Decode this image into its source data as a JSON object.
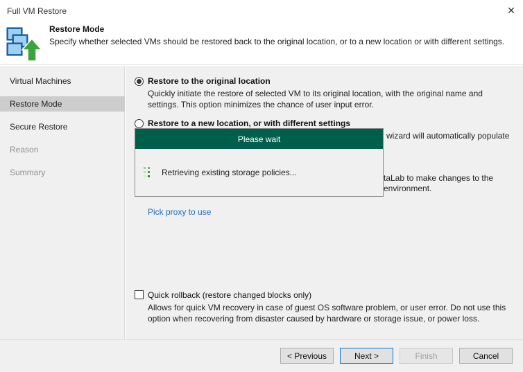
{
  "window": {
    "title": "Full VM Restore",
    "close_glyph": "✕"
  },
  "header": {
    "title": "Restore Mode",
    "description": "Specify whether selected VMs should be restored back to the original location, or to a new location or with different settings.",
    "icon": "vm-restore-icon"
  },
  "sidebar": {
    "steps": [
      {
        "label": "Virtual Machines",
        "state": "normal"
      },
      {
        "label": "Restore Mode",
        "state": "active"
      },
      {
        "label": "Secure Restore",
        "state": "normal"
      },
      {
        "label": "Reason",
        "state": "disabled"
      },
      {
        "label": "Summary",
        "state": "disabled"
      }
    ]
  },
  "main": {
    "option_original": {
      "label": "Restore to the original location",
      "desc_line1": "Quickly initiate the restore of selected VM to its original location, with the original name and",
      "desc_line2": "settings. This option minimizes the chance of user input error.",
      "selected": true
    },
    "option_new": {
      "label": "Restore to a new location, or with different settings",
      "desc_partial_1": "wizard will automatically populate",
      "desc_partial_2": "taLab to make changes to the",
      "desc_partial_3": "environment.",
      "selected": false
    },
    "pick_proxy_link": "Pick proxy to use",
    "quick_rollback": {
      "label": "Quick rollback (restore changed blocks only)",
      "desc_line1": "Allows for quick VM recovery in case of guest OS software problem, or user error. Do not use this",
      "desc_line2": "option when recovering from disaster caused by hardware or storage issue, or power loss.",
      "checked": false
    }
  },
  "wait_dialog": {
    "title": "Please wait",
    "message": "Retrieving existing storage policies..."
  },
  "footer": {
    "previous": "< Previous",
    "next": "Next >",
    "finish": "Finish",
    "cancel": "Cancel"
  },
  "colors": {
    "accent": "#005f4b",
    "link": "#1b6ac9",
    "primary_border": "#0078d7"
  }
}
